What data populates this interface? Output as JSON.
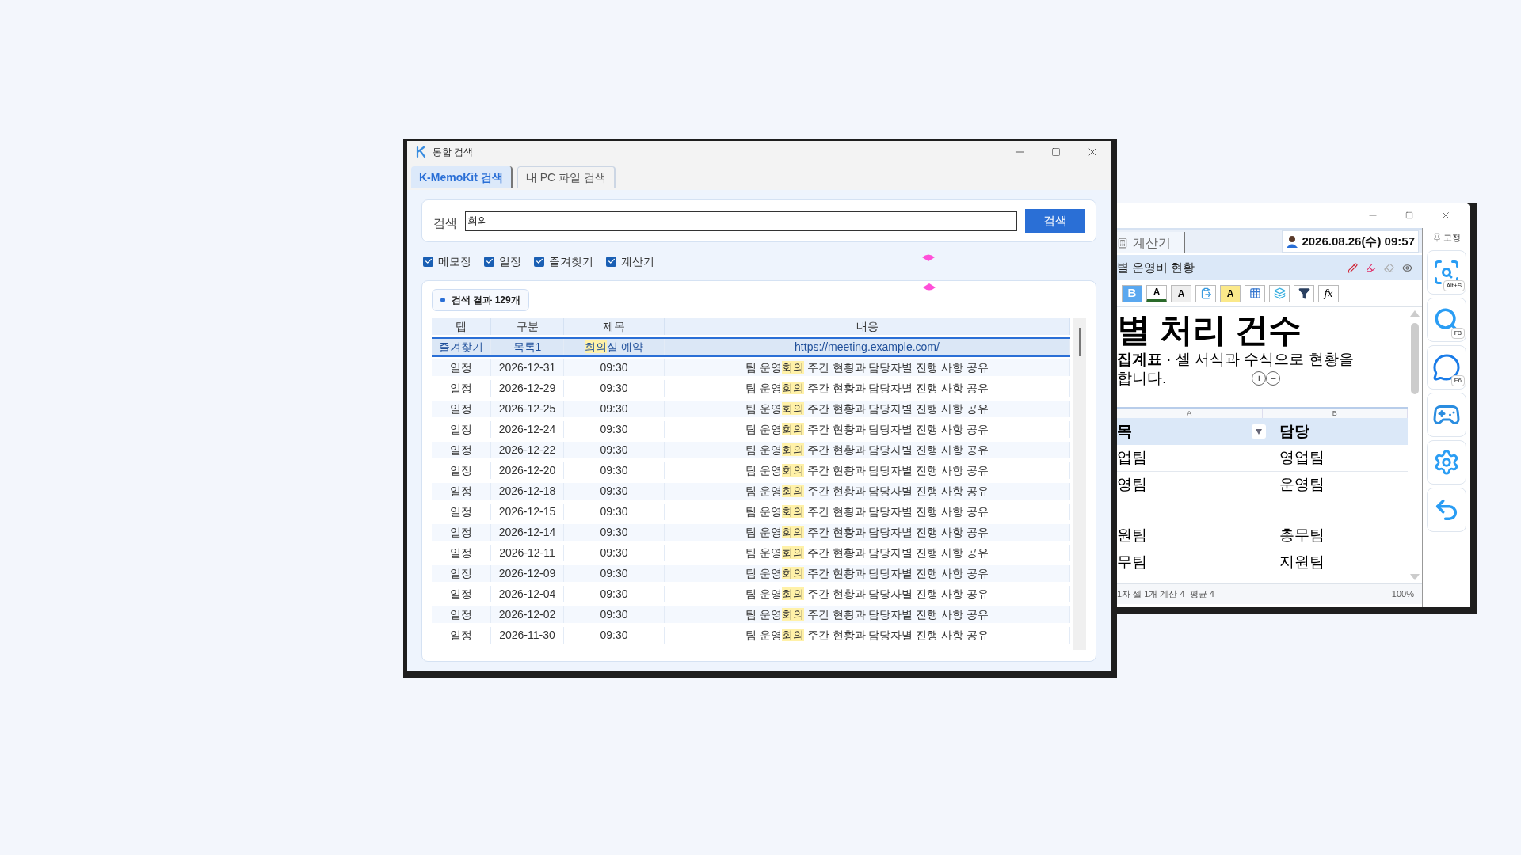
{
  "search_window": {
    "title": "통합 검색",
    "tabs": [
      {
        "label": "K-MemoKit 검색",
        "selected": true
      },
      {
        "label": "내 PC 파일 검색",
        "selected": false
      }
    ],
    "search": {
      "label": "검색",
      "value": "회의",
      "button": "검색"
    },
    "filters": [
      {
        "label": "메모장",
        "checked": true
      },
      {
        "label": "일정",
        "checked": true
      },
      {
        "label": "즐겨찾기",
        "checked": true
      },
      {
        "label": "계산기",
        "checked": true
      }
    ],
    "result_count": "검색 결과 129개",
    "table": {
      "columns": [
        "탭",
        "구분",
        "제목",
        "내용"
      ],
      "rows": [
        {
          "selected": true,
          "cells": [
            [
              {
                "text": "즐겨찾기"
              }
            ],
            [
              {
                "text": "목록1"
              }
            ],
            [
              {
                "text": "회의",
                "highlight": true
              },
              {
                "text": "실 예약"
              }
            ],
            [
              {
                "text": "https://meeting.example.com/"
              }
            ]
          ]
        },
        {
          "selected": false,
          "cells": [
            [
              {
                "text": "일정"
              }
            ],
            [
              {
                "text": "2026-12-31"
              }
            ],
            [
              {
                "text": "09:30"
              }
            ],
            [
              {
                "text": "팀 운영"
              },
              {
                "text": "회의",
                "highlight": true
              },
              {
                "text": " 주간 현황과 담당자별 진행 사항 공유"
              }
            ]
          ]
        },
        {
          "selected": false,
          "cells": [
            [
              {
                "text": "일정"
              }
            ],
            [
              {
                "text": "2026-12-29"
              }
            ],
            [
              {
                "text": "09:30"
              }
            ],
            [
              {
                "text": "팀 운영"
              },
              {
                "text": "회의",
                "highlight": true
              },
              {
                "text": " 주간 현황과 담당자별 진행 사항 공유"
              }
            ]
          ]
        },
        {
          "selected": false,
          "cells": [
            [
              {
                "text": "일정"
              }
            ],
            [
              {
                "text": "2026-12-25"
              }
            ],
            [
              {
                "text": "09:30"
              }
            ],
            [
              {
                "text": "팀 운영"
              },
              {
                "text": "회의",
                "highlight": true
              },
              {
                "text": " 주간 현황과 담당자별 진행 사항 공유"
              }
            ]
          ]
        },
        {
          "selected": false,
          "cells": [
            [
              {
                "text": "일정"
              }
            ],
            [
              {
                "text": "2026-12-24"
              }
            ],
            [
              {
                "text": "09:30"
              }
            ],
            [
              {
                "text": "팀 운영"
              },
              {
                "text": "회의",
                "highlight": true
              },
              {
                "text": " 주간 현황과 담당자별 진행 사항 공유"
              }
            ]
          ]
        },
        {
          "selected": false,
          "cells": [
            [
              {
                "text": "일정"
              }
            ],
            [
              {
                "text": "2026-12-22"
              }
            ],
            [
              {
                "text": "09:30"
              }
            ],
            [
              {
                "text": "팀 운영"
              },
              {
                "text": "회의",
                "highlight": true
              },
              {
                "text": " 주간 현황과 담당자별 진행 사항 공유"
              }
            ]
          ]
        },
        {
          "selected": false,
          "cells": [
            [
              {
                "text": "일정"
              }
            ],
            [
              {
                "text": "2026-12-20"
              }
            ],
            [
              {
                "text": "09:30"
              }
            ],
            [
              {
                "text": "팀 운영"
              },
              {
                "text": "회의",
                "highlight": true
              },
              {
                "text": " 주간 현황과 담당자별 진행 사항 공유"
              }
            ]
          ]
        },
        {
          "selected": false,
          "cells": [
            [
              {
                "text": "일정"
              }
            ],
            [
              {
                "text": "2026-12-18"
              }
            ],
            [
              {
                "text": "09:30"
              }
            ],
            [
              {
                "text": "팀 운영"
              },
              {
                "text": "회의",
                "highlight": true
              },
              {
                "text": " 주간 현황과 담당자별 진행 사항 공유"
              }
            ]
          ]
        },
        {
          "selected": false,
          "cells": [
            [
              {
                "text": "일정"
              }
            ],
            [
              {
                "text": "2026-12-15"
              }
            ],
            [
              {
                "text": "09:30"
              }
            ],
            [
              {
                "text": "팀 운영"
              },
              {
                "text": "회의",
                "highlight": true
              },
              {
                "text": " 주간 현황과 담당자별 진행 사항 공유"
              }
            ]
          ]
        },
        {
          "selected": false,
          "cells": [
            [
              {
                "text": "일정"
              }
            ],
            [
              {
                "text": "2026-12-14"
              }
            ],
            [
              {
                "text": "09:30"
              }
            ],
            [
              {
                "text": "팀 운영"
              },
              {
                "text": "회의",
                "highlight": true
              },
              {
                "text": " 주간 현황과 담당자별 진행 사항 공유"
              }
            ]
          ]
        },
        {
          "selected": false,
          "cells": [
            [
              {
                "text": "일정"
              }
            ],
            [
              {
                "text": "2026-12-11"
              }
            ],
            [
              {
                "text": "09:30"
              }
            ],
            [
              {
                "text": "팀 운영"
              },
              {
                "text": "회의",
                "highlight": true
              },
              {
                "text": " 주간 현황과 담당자별 진행 사항 공유"
              }
            ]
          ]
        },
        {
          "selected": false,
          "cells": [
            [
              {
                "text": "일정"
              }
            ],
            [
              {
                "text": "2026-12-09"
              }
            ],
            [
              {
                "text": "09:30"
              }
            ],
            [
              {
                "text": "팀 운영"
              },
              {
                "text": "회의",
                "highlight": true
              },
              {
                "text": " 주간 현황과 담당자별 진행 사항 공유"
              }
            ]
          ]
        },
        {
          "selected": false,
          "cells": [
            [
              {
                "text": "일정"
              }
            ],
            [
              {
                "text": "2026-12-04"
              }
            ],
            [
              {
                "text": "09:30"
              }
            ],
            [
              {
                "text": "팀 운영"
              },
              {
                "text": "회의",
                "highlight": true
              },
              {
                "text": " 주간 현황과 담당자별 진행 사항 공유"
              }
            ]
          ]
        },
        {
          "selected": false,
          "cells": [
            [
              {
                "text": "일정"
              }
            ],
            [
              {
                "text": "2026-12-02"
              }
            ],
            [
              {
                "text": "09:30"
              }
            ],
            [
              {
                "text": "팀 운영"
              },
              {
                "text": "회의",
                "highlight": true
              },
              {
                "text": " 주간 현황과 담당자별 진행 사항 공유"
              }
            ]
          ]
        },
        {
          "selected": false,
          "cells": [
            [
              {
                "text": "일정"
              }
            ],
            [
              {
                "text": "2026-11-30"
              }
            ],
            [
              {
                "text": "09:30"
              }
            ],
            [
              {
                "text": "팀 운영"
              },
              {
                "text": "회의",
                "highlight": true
              },
              {
                "text": " 주간 현황과 담당자별 진행 사항 공유"
              }
            ]
          ]
        }
      ]
    }
  },
  "memo_window": {
    "tab": "계산기",
    "datetime": "2026.08.26(수) 09:57",
    "pin": "고정",
    "note_title": "별 운영비 현황",
    "toolbar": [
      {
        "kind": "bold",
        "label": "B"
      },
      {
        "kind": "font_color",
        "label": "A"
      },
      {
        "kind": "shade",
        "label": "A"
      },
      {
        "kind": "paste"
      },
      {
        "kind": "highlight",
        "label": "A"
      },
      {
        "kind": "grid"
      },
      {
        "kind": "layers"
      },
      {
        "kind": "filter"
      },
      {
        "kind": "formula",
        "label": "fx"
      }
    ],
    "heading": "별 처리 건수",
    "description": "**집계표** · 셀 서식과 수식으로 현황을",
    "description_2": "합니다.",
    "zoom_buttons": [
      "+",
      "−"
    ],
    "sheet": {
      "column_letters": [
        "A",
        "B"
      ],
      "header": [
        "목",
        "담당"
      ],
      "rows": [
        {
          "cells": [
            "업팀",
            "영업팀"
          ],
          "tall": false
        },
        {
          "cells": [
            "영팀",
            "운영팀"
          ],
          "tall": true
        },
        {
          "cells": [
            "원팀",
            "총무팀"
          ],
          "tall": false
        },
        {
          "cells": [
            "무팀",
            "지원팀"
          ],
          "tall": false
        }
      ]
    },
    "status": "1자 셀 1개 계산 4  평균 4",
    "zoom": "100%",
    "side_buttons": [
      {
        "kind": "capture",
        "shortcut": "Alt+S"
      },
      {
        "kind": "search",
        "shortcut": "F3"
      },
      {
        "kind": "chat",
        "shortcut": "F6"
      },
      {
        "kind": "game"
      },
      {
        "kind": "settings"
      },
      {
        "kind": "undo"
      }
    ]
  }
}
